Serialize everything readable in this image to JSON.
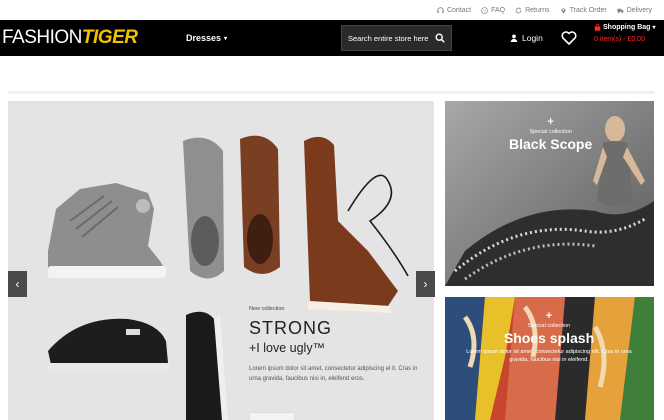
{
  "utility_links": [
    {
      "label": "Contact",
      "icon": "headset-icon"
    },
    {
      "label": "FAQ",
      "icon": "question-icon"
    },
    {
      "label": "Returns",
      "icon": "refresh-icon"
    },
    {
      "label": "Track Order",
      "icon": "pin-icon"
    },
    {
      "label": "Delivery",
      "icon": "truck-icon"
    }
  ],
  "header": {
    "logo_part1": "FASHION",
    "logo_part2": "TIGER",
    "nav": {
      "dresses": "Dresses"
    },
    "search_placeholder": "Search entire store here...",
    "login": "Login",
    "cart_title": "Shopping Bag",
    "cart_count": "0 item(s) - £0.00"
  },
  "slider": {
    "caption_small": "New collection",
    "caption_title": "STRONG",
    "caption_sub": "+I love ugly™",
    "caption_text": "Lorem ipsum dolor sit amet, consectetur adipiscing el it. Cras in urna gravida, faucibus nisi in, eleifend eros.",
    "prev": "‹",
    "next": "›"
  },
  "banners": [
    {
      "plus": "+",
      "subtitle": "Special collection",
      "title": "Black Scope"
    },
    {
      "plus": "+",
      "subtitle": "Special collection",
      "title": "Shoes splash",
      "desc": "Lorem ipsum dolor sit amet, consectetur adipiscing elit. Cras in urna gravida, faucibus nisi in eleifend."
    }
  ],
  "colors": {
    "header_bg": "#000000",
    "logo_accent": "#f2c200",
    "cart_red": "#ff2a2a"
  }
}
